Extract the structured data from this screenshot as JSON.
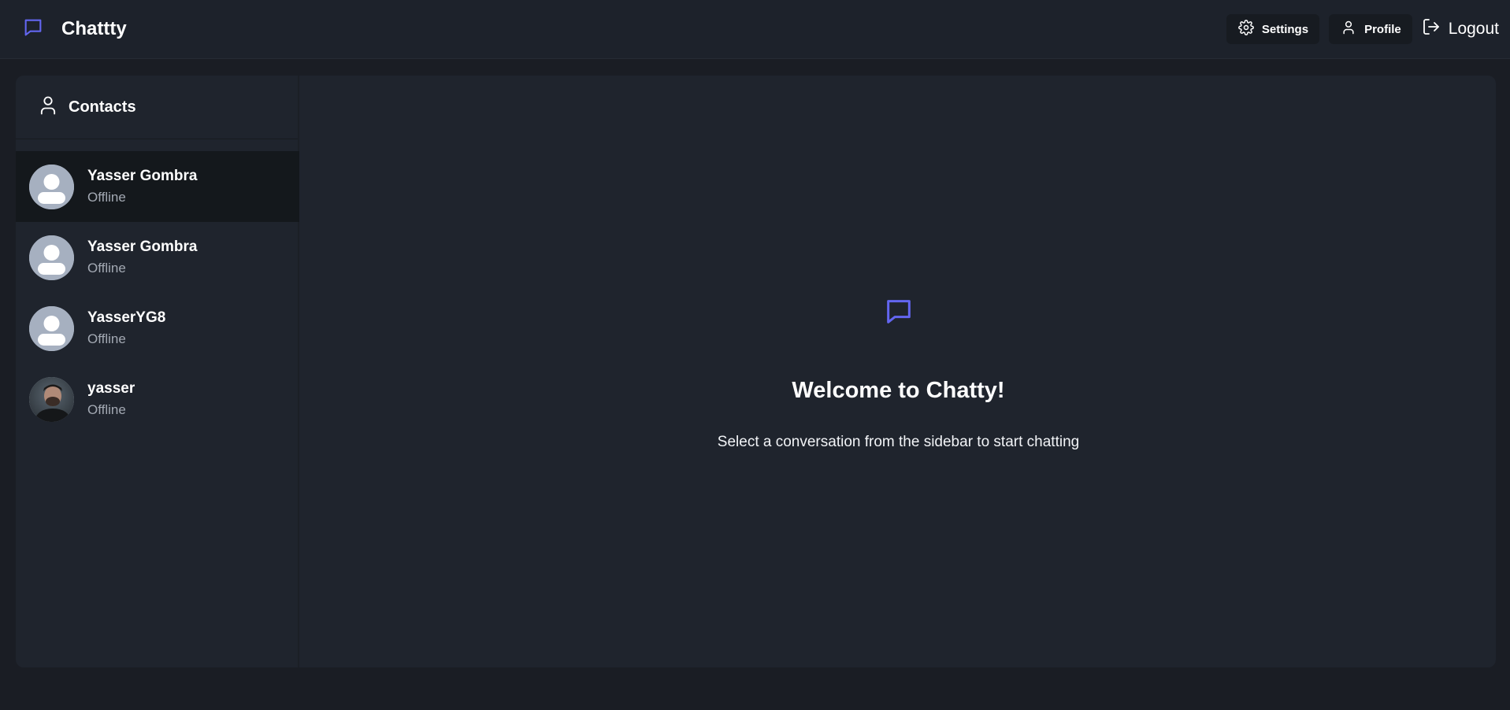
{
  "app": {
    "name": "Chattty",
    "accent_color": "#6366f1"
  },
  "nav": {
    "settings_label": "Settings",
    "profile_label": "Profile",
    "logout_label": "Logout"
  },
  "sidebar": {
    "title": "Contacts",
    "contacts": [
      {
        "name": "Yasser Gombra",
        "status": "Offline",
        "avatar": "default-avatar-icon",
        "selected": true
      },
      {
        "name": "Yasser Gombra",
        "status": "Offline",
        "avatar": "default-avatar-icon",
        "selected": false
      },
      {
        "name": "YasserYG8",
        "status": "Offline",
        "avatar": "default-avatar-icon",
        "selected": false
      },
      {
        "name": "yasser",
        "status": "Offline",
        "avatar": "photo-avatar",
        "selected": false
      }
    ]
  },
  "welcome": {
    "title": "Welcome to Chatty!",
    "subtitle": "Select a conversation from the sidebar to start chatting"
  }
}
